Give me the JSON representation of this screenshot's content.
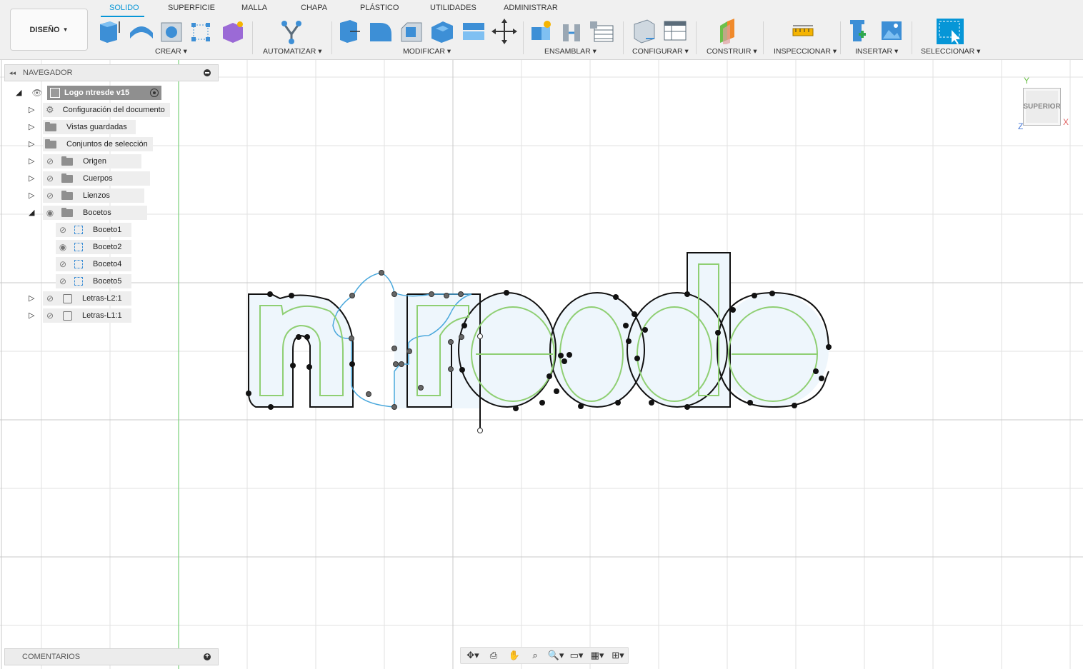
{
  "toolbar": {
    "workspace_label": "DISEÑO",
    "tabs": [
      {
        "label": "SOLIDO",
        "active": true
      },
      {
        "label": "SUPERFICIE",
        "active": false
      },
      {
        "label": "MALLA",
        "active": false
      },
      {
        "label": "CHAPA",
        "active": false
      },
      {
        "label": "PLÁSTICO",
        "active": false
      },
      {
        "label": "UTILIDADES",
        "active": false
      },
      {
        "label": "ADMINISTRAR",
        "active": false
      }
    ],
    "groups": [
      {
        "label": "CREAR ▾"
      },
      {
        "label": "AUTOMATIZAR ▾"
      },
      {
        "label": "MODIFICAR ▾"
      },
      {
        "label": "ENSAMBLAR ▾"
      },
      {
        "label": "CONFIGURAR ▾"
      },
      {
        "label": "CONSTRUIR ▾"
      },
      {
        "label": "INSPECCIONAR ▾"
      },
      {
        "label": "INSERTAR ▾"
      },
      {
        "label": "SELECCIONAR ▾"
      }
    ],
    "accent_color": "#0696d7"
  },
  "browser": {
    "title": "NAVEGADOR",
    "root": "Logo ntresde v15",
    "items": [
      {
        "label": "Configuración del documento",
        "icon": "gear-icon"
      },
      {
        "label": "Vistas guardadas",
        "icon": "folder-icon"
      },
      {
        "label": "Conjuntos de selección",
        "icon": "folder-icon"
      },
      {
        "label": "Origen",
        "icon": "folder-icon"
      },
      {
        "label": "Cuerpos",
        "icon": "folder-icon"
      },
      {
        "label": "Lienzos",
        "icon": "folder-icon"
      },
      {
        "label": "Bocetos",
        "icon": "folder-icon"
      },
      {
        "label": "Boceto1",
        "icon": "sketch-icon"
      },
      {
        "label": "Boceto2",
        "icon": "sketch-icon"
      },
      {
        "label": "Boceto4",
        "icon": "sketch-icon"
      },
      {
        "label": "Boceto5",
        "icon": "sketch-icon"
      },
      {
        "label": "Letras-L2:1",
        "icon": "component-icon"
      },
      {
        "label": "Letras-L1:1",
        "icon": "component-icon"
      }
    ]
  },
  "comments": {
    "title": "COMENTARIOS"
  },
  "viewcube": {
    "face": "SUPERIOR",
    "axis_y": "Y",
    "axis_x": "X",
    "axis_z": "Z"
  },
  "sketch_text": "ntresde"
}
